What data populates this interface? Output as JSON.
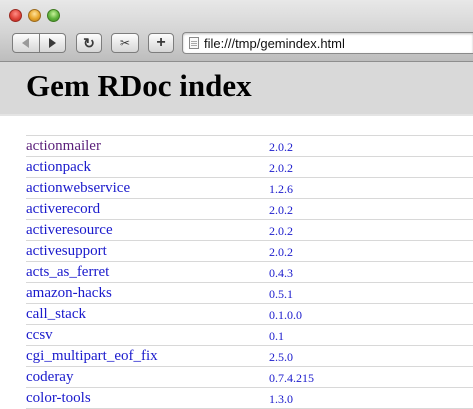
{
  "browser": {
    "url": "file:///tmp/gemindex.html",
    "icons": {
      "back": "back-arrow-icon",
      "forward": "forward-arrow-icon",
      "reload": "reload-icon",
      "snippet": "snip-icon",
      "add_bookmark": "plus-icon",
      "page": "page-icon"
    },
    "reload_glyph": "↻",
    "add_glyph": "+",
    "snip_glyph": "✂"
  },
  "page": {
    "title": "Gem RDoc index",
    "gems": [
      {
        "name": "actionmailer",
        "version": "2.0.2",
        "visited": true
      },
      {
        "name": "actionpack",
        "version": "2.0.2",
        "visited": false
      },
      {
        "name": "actionwebservice",
        "version": "1.2.6",
        "visited": false
      },
      {
        "name": "activerecord",
        "version": "2.0.2",
        "visited": false
      },
      {
        "name": "activeresource",
        "version": "2.0.2",
        "visited": false
      },
      {
        "name": "activesupport",
        "version": "2.0.2",
        "visited": false
      },
      {
        "name": "acts_as_ferret",
        "version": "0.4.3",
        "visited": false
      },
      {
        "name": "amazon-hacks",
        "version": "0.5.1",
        "visited": false
      },
      {
        "name": "call_stack",
        "version": "0.1.0.0",
        "visited": false
      },
      {
        "name": "ccsv",
        "version": "0.1",
        "visited": false
      },
      {
        "name": "cgi_multipart_eof_fix",
        "version": "2.5.0",
        "visited": false
      },
      {
        "name": "coderay",
        "version": "0.7.4.215",
        "visited": false
      },
      {
        "name": "color-tools",
        "version": "1.3.0",
        "visited": false
      }
    ]
  },
  "colors": {
    "link": "#1a1acc",
    "visited_link": "#5a1f7a",
    "header_band": "#d9d9d9"
  }
}
